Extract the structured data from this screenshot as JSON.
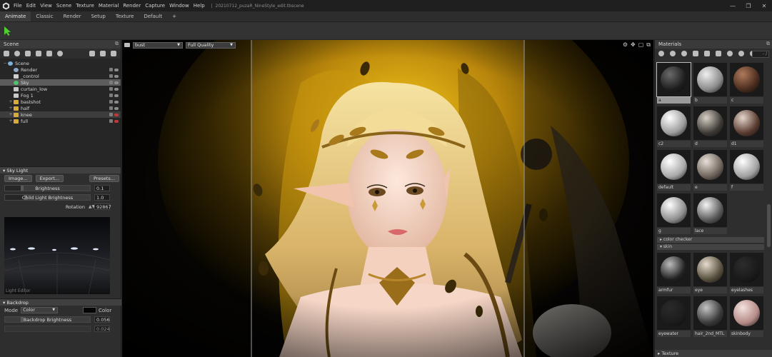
{
  "window": {
    "title": "20210712_puzaR_NineStyle_edit.tbscene",
    "menu": [
      "File",
      "Edit",
      "View",
      "Scene",
      "Texture",
      "Material",
      "Render",
      "Capture",
      "Window",
      "Help"
    ],
    "controls": [
      "—",
      "❐",
      "✕"
    ]
  },
  "tabs": [
    "Animate",
    "Classic",
    "Render",
    "Setup",
    "Texture",
    "Default",
    "+"
  ],
  "scene_panel": {
    "title": "Scene",
    "tree": [
      {
        "label": "Scene",
        "depth": 0,
        "kind": "scene",
        "expander": "−"
      },
      {
        "label": "Render",
        "depth": 1,
        "kind": "render"
      },
      {
        "label": "_control",
        "depth": 1,
        "kind": "control"
      },
      {
        "label": "Sky",
        "depth": 1,
        "kind": "sky",
        "selected": true
      },
      {
        "label": "curtain_low",
        "depth": 1,
        "kind": "mesh"
      },
      {
        "label": "Fog 1",
        "depth": 1,
        "kind": "fog"
      },
      {
        "label": "bastshot",
        "depth": 1,
        "kind": "folder",
        "expander": "+"
      },
      {
        "label": "half",
        "depth": 1,
        "kind": "folder",
        "expander": "+"
      },
      {
        "label": "knee",
        "depth": 1,
        "kind": "folder",
        "expander": "+",
        "highlight": true,
        "hidden": true
      },
      {
        "label": "full",
        "depth": 1,
        "kind": "folder",
        "expander": "+",
        "hidden": true
      }
    ]
  },
  "sky_light": {
    "title": "Sky Light",
    "buttons": [
      "Image...",
      "Export...",
      "Presets..."
    ],
    "brightness": {
      "label": "Brightness",
      "value": "0.1",
      "level": 0.18
    },
    "child_brightness": {
      "label": "Child Light Brightness",
      "value": "1.0",
      "level": 0.22
    },
    "rotation": {
      "label": "Rotation",
      "value": "92867"
    },
    "editor_label": "Light Editor"
  },
  "backdrop": {
    "title": "Backdrop",
    "mode_label": "Mode",
    "mode_value": "Color",
    "color_label": "Color",
    "swatch": "#050505",
    "brightness": {
      "label": "Backdrop Brightness",
      "value": "0.056"
    },
    "second_value": "0.024"
  },
  "viewport": {
    "camera": "bust",
    "quality": "Full Quality",
    "icons": [
      "gear-icon",
      "move-icon",
      "frame-icon",
      "popout-icon"
    ]
  },
  "materials": {
    "title": "Materials",
    "search": "- /",
    "items": [
      {
        "name": "a",
        "color": "#1e1e1e",
        "hi": "#6a6a6a",
        "selected": true
      },
      {
        "name": "b",
        "color": "#8a8a8a",
        "hi": "#f0f0f0"
      },
      {
        "name": "c",
        "color": "#4a2c1e",
        "hi": "#b07a5c"
      },
      {
        "name": "c2",
        "color": "#9c9c9c",
        "hi": "#ffffff"
      },
      {
        "name": "d",
        "color": "#3e3a36",
        "hi": "#d8d0c6"
      },
      {
        "name": "d1",
        "color": "#5a3c30",
        "hi": "#e4d6cc"
      },
      {
        "name": "default",
        "color": "#a8a8a8",
        "hi": "#ffffff"
      },
      {
        "name": "e",
        "color": "#6e645c",
        "hi": "#e8e0d8"
      },
      {
        "name": "f",
        "color": "#a0a0a0",
        "hi": "#ffffff"
      },
      {
        "name": "g",
        "color": "#8e8e8e",
        "hi": "#ffffff"
      },
      {
        "name": "lace",
        "color": "#5a5a5a",
        "hi": "#f4f4f4"
      }
    ],
    "groups": [
      "color checker",
      "skin"
    ],
    "skin_items": [
      {
        "name": "armfur",
        "color": "#202020",
        "hi": "#bcbcbc"
      },
      {
        "name": "eye",
        "color": "#58503e",
        "hi": "#e6dccf"
      },
      {
        "name": "eyelashes",
        "color": "#1a1a1a",
        "hi": "#2c2c2c"
      },
      {
        "name": "eyewater",
        "color": "#1c1c1c",
        "hi": "#2a2a2a"
      },
      {
        "name": "hair_2nd_MTL",
        "color": "#3a3a3a",
        "hi": "#c4c4c4"
      },
      {
        "name": "skinbody",
        "color": "#b48a86",
        "hi": "#f4e2de"
      }
    ],
    "texture_label": "Texture"
  }
}
